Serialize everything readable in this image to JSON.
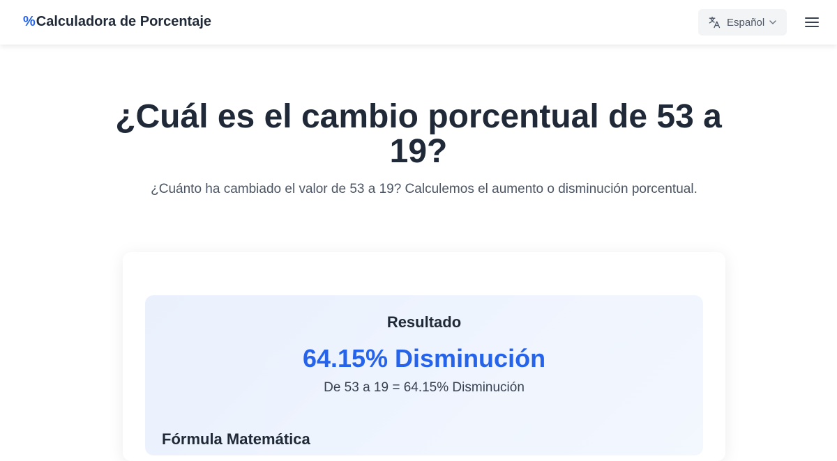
{
  "header": {
    "logo_mark": "%",
    "logo_text": "Calculadora de Porcentaje",
    "language": "Español"
  },
  "hero": {
    "title": "¿Cuál es el cambio porcentual de 53 a 19?",
    "subtitle": "¿Cuánto ha cambiado el valor de 53 a 19? Calculemos el aumento o disminución porcentual."
  },
  "result": {
    "label": "Resultado",
    "value": "64.15% Disminución",
    "detail": "De 53 a 19 = 64.15% Disminución"
  },
  "formula": {
    "title": "Fórmula Matemática"
  },
  "icons": {
    "language": "translate-icon",
    "dropdown": "chevron-down-icon",
    "menu": "hamburger-menu-icon"
  },
  "colors": {
    "accent": "#2563eb",
    "text": "#1f2937",
    "muted": "#4b5563",
    "result_bg": "#eaf1fd",
    "lang_bg": "#f3f4f6"
  }
}
